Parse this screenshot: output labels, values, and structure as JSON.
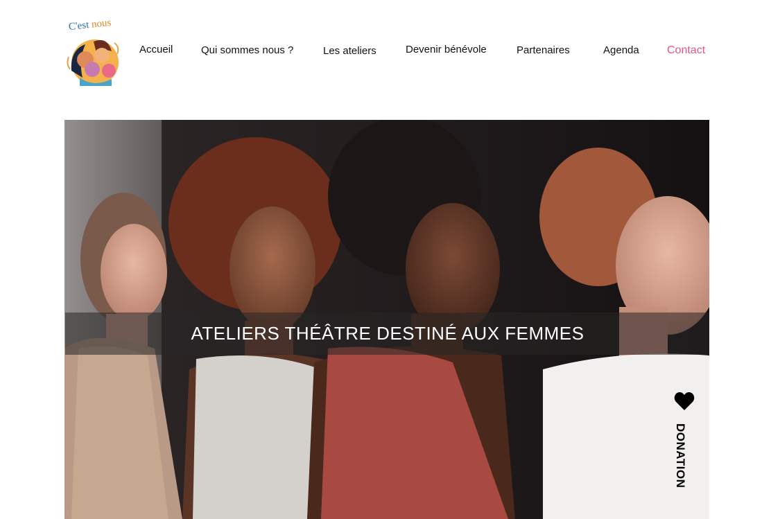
{
  "brand": {
    "logo_text_a": "C'est ",
    "logo_text_b": "nous"
  },
  "nav": {
    "items": [
      "Accueil",
      "Qui sommes nous ?",
      "Les ateliers",
      "Devenir bénévole",
      "Partenaires",
      "Agenda"
    ],
    "contact": "Contact"
  },
  "hero": {
    "title": "ATELIERS THÉÂTRE DESTINÉ AUX FEMMES"
  },
  "donation": {
    "label": "DONATION",
    "icon": "heart-icon"
  },
  "colors": {
    "accent": "#e15586",
    "banner": "#282626"
  }
}
